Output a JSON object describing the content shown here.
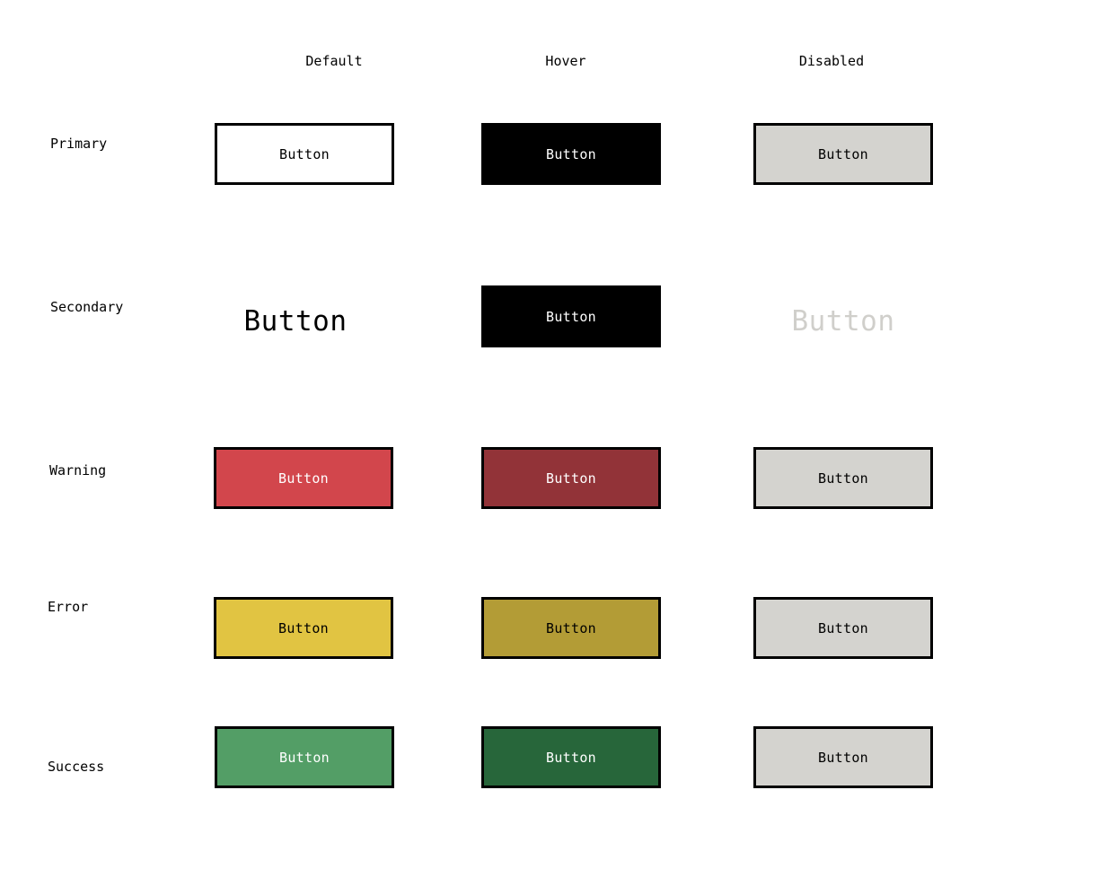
{
  "columns": {
    "default": "Default",
    "hover": "Hover",
    "disabled": "Disabled"
  },
  "rows": {
    "primary": {
      "label": "Primary",
      "default": {
        "label": "Button",
        "bg": "#ffffff",
        "fg": "#000000"
      },
      "hover": {
        "label": "Button",
        "bg": "#000000",
        "fg": "#ffffff"
      },
      "disabled": {
        "label": "Button",
        "bg": "#d4d3cf",
        "fg": "#000000"
      }
    },
    "secondary": {
      "label": "Secondary",
      "default": {
        "label": "Button",
        "fg": "#000000"
      },
      "hover": {
        "label": "Button",
        "bg": "#000000",
        "fg": "#ffffff"
      },
      "disabled": {
        "label": "Button",
        "fg": "#d0cfcb"
      }
    },
    "warning": {
      "label": "Warning",
      "default": {
        "label": "Button",
        "bg": "#d2464c",
        "fg": "#ffffff"
      },
      "hover": {
        "label": "Button",
        "bg": "#923338",
        "fg": "#ffffff"
      },
      "disabled": {
        "label": "Button",
        "bg": "#d4d3cf",
        "fg": "#000000"
      }
    },
    "error": {
      "label": "Error",
      "default": {
        "label": "Button",
        "bg": "#e1c442",
        "fg": "#000000"
      },
      "hover": {
        "label": "Button",
        "bg": "#b39c36",
        "fg": "#000000"
      },
      "disabled": {
        "label": "Button",
        "bg": "#d4d3cf",
        "fg": "#000000"
      }
    },
    "success": {
      "label": "Success",
      "default": {
        "label": "Button",
        "bg": "#539e66",
        "fg": "#ffffff"
      },
      "hover": {
        "label": "Button",
        "bg": "#27663a",
        "fg": "#ffffff"
      },
      "disabled": {
        "label": "Button",
        "bg": "#d4d3cf",
        "fg": "#000000"
      }
    }
  }
}
